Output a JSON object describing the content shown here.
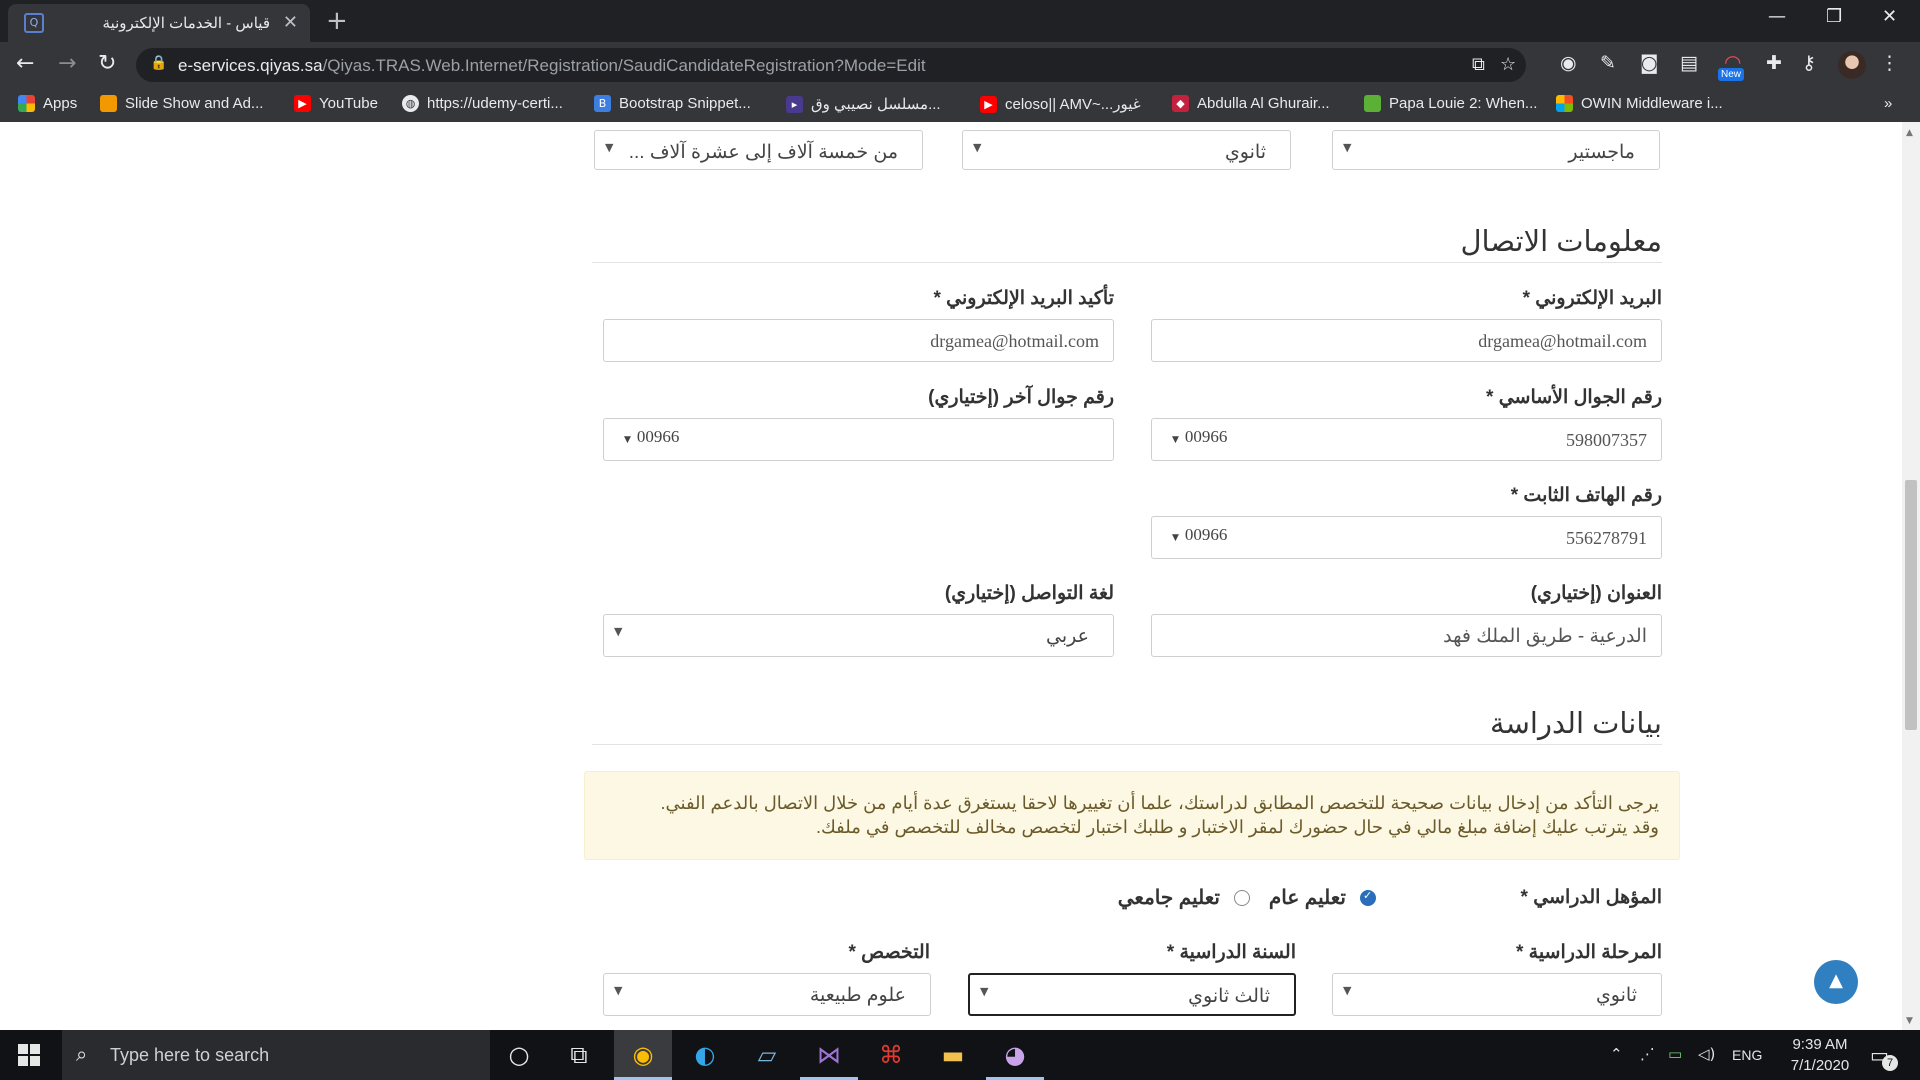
{
  "browser": {
    "tab_title": "قياس - الخدمات الإلكترونية",
    "url_host": "e-services.qiyas.sa",
    "url_path": "/Qiyas.TRAS.Web.Internet/Registration/SaudiCandidateRegistration?Mode=Edit",
    "new_badge": "New",
    "bookmarks": [
      {
        "label": "Apps",
        "icon": "apps-grid-icon",
        "color": "#ea4335"
      },
      {
        "label": "Slide Show and Ad...",
        "icon": "slideshow-icon",
        "color": "#f29900"
      },
      {
        "label": "YouTube",
        "icon": "youtube-icon",
        "color": "#ff0000"
      },
      {
        "label": "https://udemy-certi...",
        "icon": "globe-icon",
        "color": "#5f6368"
      },
      {
        "label": "Bootstrap Snippet...",
        "icon": "bootstrap-icon",
        "color": "#3d7fe0"
      },
      {
        "label": "مسلسل نصيبي وق...",
        "icon": "video-icon",
        "color": "#6b4fbb"
      },
      {
        "label": "celoso|| AMV~...غيور",
        "icon": "youtube-icon",
        "color": "#ff0000"
      },
      {
        "label": "Abdulla Al Ghurair...",
        "icon": "site-icon",
        "color": "#c5203e"
      },
      {
        "label": "Papa Louie 2: When...",
        "icon": "game-icon",
        "color": "#5bb035"
      },
      {
        "label": "OWIN Middleware i...",
        "icon": "windows-icon",
        "color": "#f25022"
      }
    ]
  },
  "top_selects": {
    "degree": "ماجستير",
    "secondary": "ثانوي",
    "income": "من خمسة آلاف إلى عشرة آلاف ..."
  },
  "contact": {
    "title": "معلومات الاتصال",
    "email_label": "البريد الإلكتروني *",
    "email_value": "drgamea@hotmail.com",
    "email_confirm_label": "تأكيد البريد الإلكتروني *",
    "email_confirm_value": "drgamea@hotmail.com",
    "mobile_label": "رقم الجوال الأساسي *",
    "mobile_code": "00966",
    "mobile_value": "598007357",
    "alt_mobile_label": "رقم جوال آخر (إختياري)",
    "alt_mobile_code": "00966",
    "landline_label": "رقم الهاتف الثابت *",
    "landline_code": "00966",
    "landline_value": "556278791",
    "address_label": "العنوان (إختياري)",
    "address_value": "الدرعية - طريق الملك فهد",
    "language_label": "لغة التواصل (إختياري)",
    "language_value": "عربي"
  },
  "study": {
    "title": "بيانات الدراسة",
    "notice_line1": "يرجى التأكد من إدخال بيانات صحيحة للتخصص المطابق لدراستك، علما أن تغييرها لاحقا يستغرق عدة أيام من خلال الاتصال بالدعم الفني.",
    "notice_line2": "وقد يترتب عليك إضافة مبلغ مالي في حال حضورك لمقر الاختبار و طلبك اختبار لتخصص مخالف للتخصص في ملفك.",
    "qualification_label": "المؤهل الدراسي *",
    "option_general": "تعليم عام",
    "option_university": "تعليم جامعي",
    "stage_label": "المرحلة الدراسية *",
    "stage_value": "ثانوي",
    "year_label": "السنة الدراسية *",
    "year_value": "ثالث ثانوي",
    "major_label": "التخصص *",
    "major_value": "علوم طبيعية"
  },
  "taskbar": {
    "search_placeholder": "Type here to search",
    "lang": "ENG",
    "time": "9:39 AM",
    "date": "7/1/2020",
    "notifications": "7"
  }
}
